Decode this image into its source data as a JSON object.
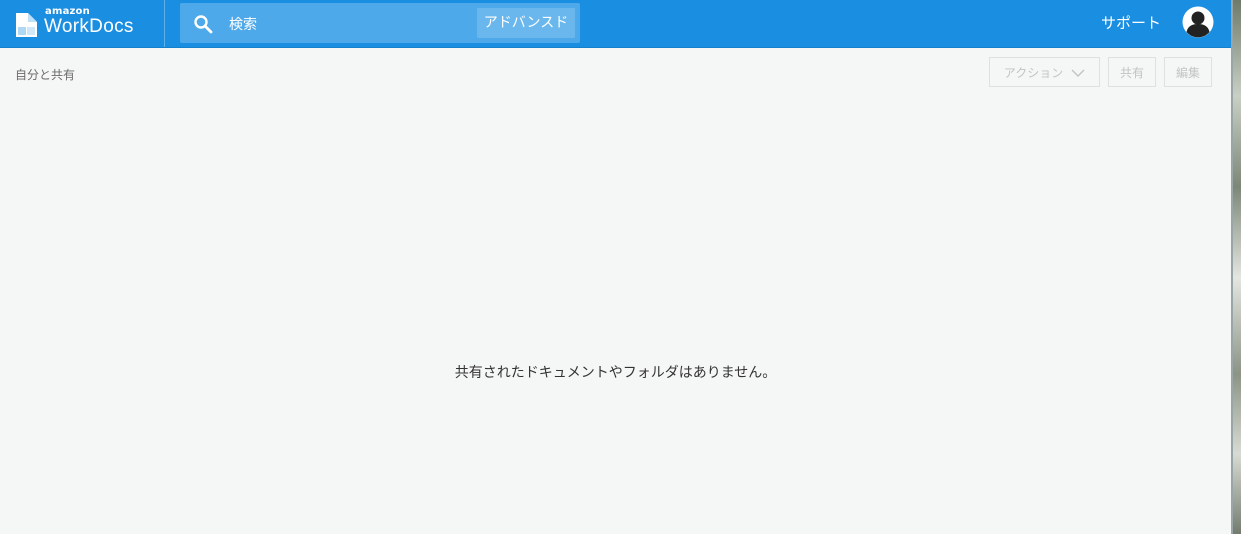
{
  "header": {
    "logo_top": "amazon",
    "logo_main": "WorkDocs",
    "search_placeholder": "検索",
    "advanced_label": "アドバンスド",
    "support_label": "サポート",
    "brand_color": "#1a8ee1"
  },
  "breadcrumb": {
    "label": "自分と共有"
  },
  "toolbar": {
    "action_label": "アクション",
    "share_label": "共有",
    "edit_label": "編集"
  },
  "main": {
    "empty_message": "共有されたドキュメントやフォルダはありません。"
  },
  "icons": {
    "logo": "workdocs-logo-icon",
    "search": "search-icon",
    "avatar": "user-avatar-icon",
    "chevron": "chevron-down-icon"
  }
}
